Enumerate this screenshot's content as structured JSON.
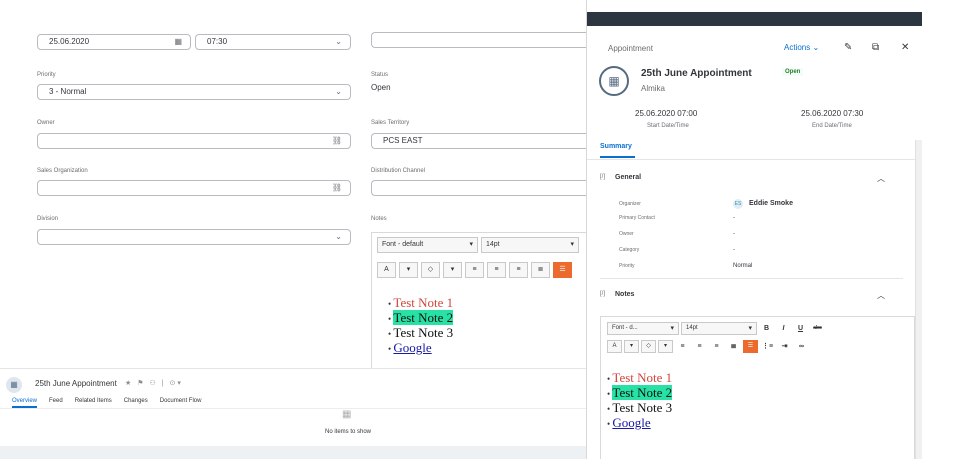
{
  "form": {
    "date_value": "25.06.2020",
    "time_value": "07:30",
    "priority_label": "Priority",
    "priority_value": "3 - Normal",
    "status_label": "Status",
    "status_value": "Open",
    "owner_label": "Owner",
    "sales_territory_label": "Sales Territory",
    "sales_territory_value": "PCS EAST",
    "sales_org_label": "Sales Organization",
    "distribution_channel_label": "Distribution Channel",
    "division_label": "Division",
    "notes_label": "Notes"
  },
  "editor": {
    "font_select": "Font - default",
    "size_select": "14pt",
    "notes": [
      "Test Note 1",
      "Test Note 2",
      "Test Note 3",
      "Google"
    ]
  },
  "object_header": {
    "title": "25th June Appointment",
    "tabs": [
      "Overview",
      "Feed",
      "Related Items",
      "Changes",
      "Document Flow"
    ],
    "empty_text": "No items to show"
  },
  "panel": {
    "type_label": "Appointment",
    "actions_label": "Actions",
    "title": "25th June Appointment",
    "status": "Open",
    "subtitle": "Almika",
    "start_value": "25.06.2020 07:00",
    "start_label": "Start Date/Time",
    "end_value": "25.06.2020 07:30",
    "end_label": "End Date/Time",
    "tab_summary": "Summary",
    "general": {
      "title": "General",
      "organizer_label": "Organizer",
      "organizer_initials": "ES",
      "organizer_value": "Eddie Smoke",
      "primary_contact_label": "Primary Contact",
      "primary_contact_value": "-",
      "owner_label": "Owner",
      "owner_value": "-",
      "category_label": "Category",
      "category_value": "-",
      "priority_label": "Priority",
      "priority_value": "Normal"
    },
    "notes": {
      "title": "Notes",
      "font_select": "Font - d...",
      "size_select": "14pt",
      "items": [
        "Test Note 1",
        "Test Note 2",
        "Test Note 3",
        "Google"
      ]
    }
  },
  "colors": {
    "accent_blue": "#0a6ed1",
    "active_orange": "#ec6a2d",
    "highlight_green": "#27e2a4",
    "note_red": "#d0463b",
    "panel_topbar": "#2b3640"
  }
}
